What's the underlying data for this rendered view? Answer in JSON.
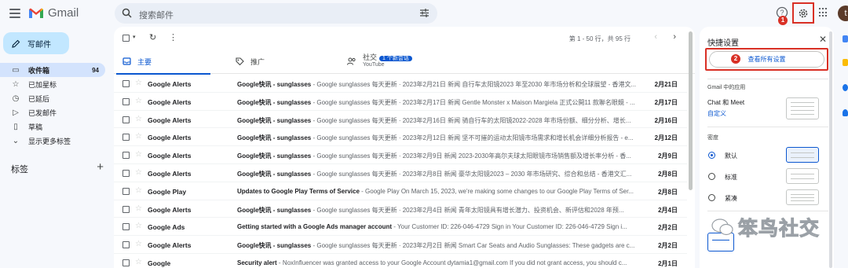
{
  "app": {
    "name": "Gmail"
  },
  "search": {
    "placeholder": "搜索邮件"
  },
  "header": {
    "avatar_letter": "t",
    "help_badge": "1"
  },
  "colors": {
    "accent": "#0b57d0",
    "annotation": "#d93025",
    "compose_bg": "#c2e7ff"
  },
  "sidebar": {
    "compose_label": "写邮件",
    "items": [
      {
        "label": "收件箱",
        "count": "94",
        "icon": "inbox-icon"
      },
      {
        "label": "已加星标",
        "count": "",
        "icon": "star-icon"
      },
      {
        "label": "已延后",
        "count": "",
        "icon": "clock-icon"
      },
      {
        "label": "已发邮件",
        "count": "",
        "icon": "send-icon"
      },
      {
        "label": "草稿",
        "count": "",
        "icon": "draft-icon"
      },
      {
        "label": "显示更多标签",
        "count": "",
        "icon": "chevron-down-icon"
      }
    ],
    "labels_heading": "标签"
  },
  "toolbar": {
    "range": "第 1 - 50 行，共 95 行"
  },
  "tabs": {
    "primary": "主要",
    "promotions": "推广",
    "social": "社交",
    "social_badge": "1 个新会话",
    "social_sub": "YouTube"
  },
  "emails": [
    {
      "sender": "Google Alerts",
      "subject": "Google快讯 - sunglasses",
      "snippet": " - Google sunglasses 每天更新 · 2023年2月21日 新闻 自行车太阳镜2023 年至2030 年市场分析和全球展望 - 香港文...",
      "date": "2月21日"
    },
    {
      "sender": "Google Alerts",
      "subject": "Google快讯 - sunglasses",
      "snippet": " - Google sunglasses 每天更新 · 2023年2月17日 新闻 Gentle Monster x Maison Margiela 正式公開11 款聯名眼鏡 - ...",
      "date": "2月17日"
    },
    {
      "sender": "Google Alerts",
      "subject": "Google快讯 - sunglasses",
      "snippet": " - Google sunglasses 每天更新 · 2023年2月16日 新闻 骑自行车的太阳镜2022-2028 年市场份额、细分分析、增长...",
      "date": "2月16日"
    },
    {
      "sender": "Google Alerts",
      "subject": "Google快讯 - sunglasses",
      "snippet": " - Google sunglasses 每天更新 · 2023年2月12日 新闻 坚不可摧的运动太阳镜市场需求和增长机会详细分析报告 - e...",
      "date": "2月12日"
    },
    {
      "sender": "Google Alerts",
      "subject": "Google快讯 - sunglasses",
      "snippet": " - Google sunglasses 每天更新 · 2023年2月9日 新闻 2023-2030年高尔夫球太阳眼镜市场销售额及增长率分析 - 香...",
      "date": "2月9日"
    },
    {
      "sender": "Google Alerts",
      "subject": "Google快讯 - sunglasses",
      "snippet": " - Google sunglasses 每天更新 · 2023年2月8日 新闻 豪华太阳镜2023 – 2030 年市场研究、综合和总结 - 香港文汇...",
      "date": "2月8日"
    },
    {
      "sender": "Google Play",
      "subject": "Updates to Google Play Terms of Service",
      "snippet": " - Google Play On March 15, 2023, we're making some changes to our Google Play Terms of Ser...",
      "date": "2月8日"
    },
    {
      "sender": "Google Alerts",
      "subject": "Google快讯 - sunglasses",
      "snippet": " - Google sunglasses 每天更新 · 2023年2月4日 新闻 青年太阳镜具有增长潜力、投资机会、新评估和2028 年预...",
      "date": "2月4日"
    },
    {
      "sender": "Google Ads",
      "subject": "Getting started with a Google Ads manager account",
      "snippet": " - Your Customer ID: 226-046-4729 Sign in Your Customer ID: 226-046-4729 Sign i...",
      "date": "2月2日"
    },
    {
      "sender": "Google Alerts",
      "subject": "Google快讯 - sunglasses",
      "snippet": " - Google sunglasses 每天更新 · 2023年2月2日 新闻 Smart Car Seats and Audio Sunglasses: These gadgets are c...",
      "date": "2月2日"
    },
    {
      "sender": "Google",
      "subject": "Security alert",
      "snippet": " - NoxInfluencer was granted access to your Google Account dytamia1@gmail.com If you did not grant access, you should c...",
      "date": "2月1日"
    }
  ],
  "quick_settings": {
    "title": "快捷设置",
    "see_all": "查看所有设置",
    "see_all_badge": "2",
    "apps_heading": "Gmail 中的应用",
    "chat_meet": "Chat 和 Meet",
    "customize": "自定义",
    "density_heading": "密度",
    "density_options": [
      {
        "label": "默认",
        "selected": true
      },
      {
        "label": "标准",
        "selected": false
      },
      {
        "label": "紧凑",
        "selected": false
      }
    ]
  },
  "watermark": {
    "text": "笨鸟社交"
  }
}
